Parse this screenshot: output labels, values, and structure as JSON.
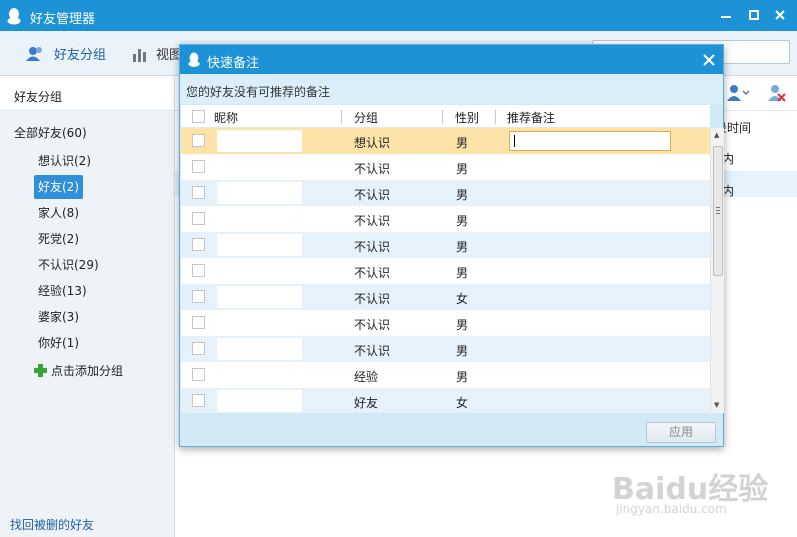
{
  "window": {
    "title": "好友管理器",
    "min_icon": "minimize-icon",
    "max_icon": "maximize-icon",
    "close_icon": "close-icon"
  },
  "toolbar": {
    "friend_group": "好友分组",
    "view": "视图"
  },
  "sidebar": {
    "header": "好友分组",
    "root": "全部好友(60)",
    "items": [
      {
        "label": "想认识(2)"
      },
      {
        "label": "好友(2)"
      },
      {
        "label": "家人(8)"
      },
      {
        "label": "死党(2)"
      },
      {
        "label": "不认识(29)"
      },
      {
        "label": "经验(13)"
      },
      {
        "label": "婆家(3)"
      },
      {
        "label": "你好(1)"
      }
    ],
    "add_group": "点击添加分组",
    "recover": "找回被删的好友"
  },
  "content": {
    "login_col": "录时间",
    "peek_text": "内"
  },
  "dialog": {
    "title": "快速备注",
    "notice": "您的好友没有可推荐的备注",
    "headers": {
      "nick": "昵称",
      "group": "分组",
      "gender": "性别",
      "remark": "推荐备注"
    },
    "rows": [
      {
        "group": "想认识",
        "gender": "男"
      },
      {
        "group": "不认识",
        "gender": "男"
      },
      {
        "group": "不认识",
        "gender": "男"
      },
      {
        "group": "不认识",
        "gender": "男"
      },
      {
        "group": "不认识",
        "gender": "男"
      },
      {
        "group": "不认识",
        "gender": "男"
      },
      {
        "group": "不认识",
        "gender": "女"
      },
      {
        "group": "不认识",
        "gender": "男"
      },
      {
        "group": "不认识",
        "gender": "男"
      },
      {
        "group": "经验",
        "gender": "男"
      },
      {
        "group": "好友",
        "gender": "女"
      }
    ],
    "apply": "应用"
  },
  "watermark": {
    "big": "Baidu经验",
    "small": "jingyan.baidu.com"
  }
}
